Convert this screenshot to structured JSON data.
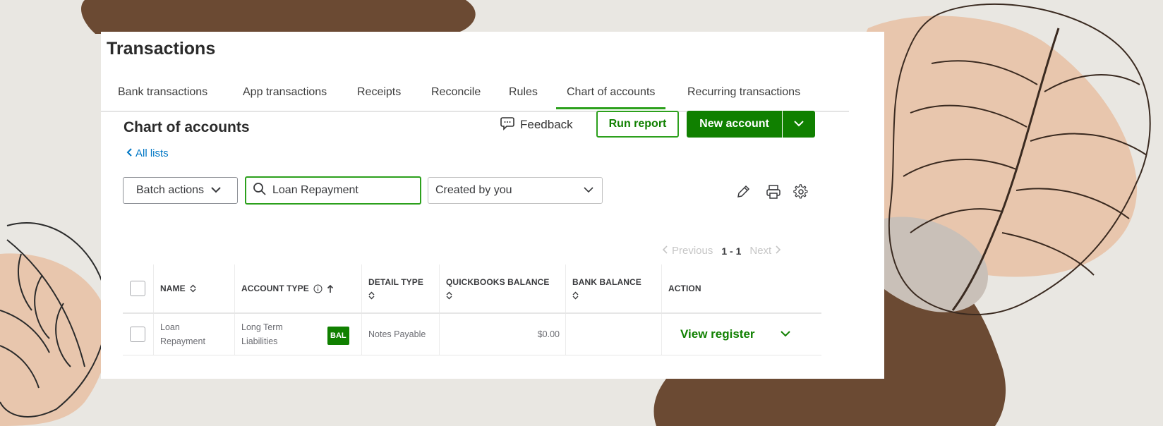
{
  "page": {
    "title": "Transactions"
  },
  "tabs": [
    {
      "label": "Bank transactions",
      "active": false
    },
    {
      "label": "App transactions",
      "active": false
    },
    {
      "label": "Receipts",
      "active": false
    },
    {
      "label": "Reconcile",
      "active": false
    },
    {
      "label": "Rules",
      "active": false
    },
    {
      "label": "Chart of accounts",
      "active": true
    },
    {
      "label": "Recurring transactions",
      "active": false
    }
  ],
  "section": {
    "title": "Chart of accounts",
    "back_link": "All lists",
    "feedback_label": "Feedback",
    "run_report_label": "Run report",
    "new_account_label": "New account"
  },
  "toolbar": {
    "batch_label": "Batch actions",
    "search_value": "Loan Repayment",
    "filter_value": "Created by you"
  },
  "pager": {
    "previous": "Previous",
    "range": "1 - 1",
    "next": "Next"
  },
  "table": {
    "columns": {
      "name": "NAME",
      "account_type": "ACCOUNT TYPE",
      "detail_type": "DETAIL TYPE",
      "qb_balance": "QUICKBOOKS BALANCE",
      "bank_balance": "BANK BALANCE",
      "action": "ACTION"
    },
    "rows": [
      {
        "name_line1": "Loan",
        "name_line2": "Repayment",
        "type_line1": "Long Term",
        "type_line2": "Liabilities",
        "badge": "BAL",
        "detail_type": "Notes Payable",
        "qb_balance": "$0.00",
        "bank_balance": "",
        "action": "View register"
      }
    ]
  },
  "colors": {
    "brand_green": "#2ca01c",
    "dark_green": "#108000",
    "link_blue": "#0077c5",
    "background": "#e9e7e2",
    "blob_brown": "#6b4a33",
    "blob_peach": "#e8c6ad"
  }
}
